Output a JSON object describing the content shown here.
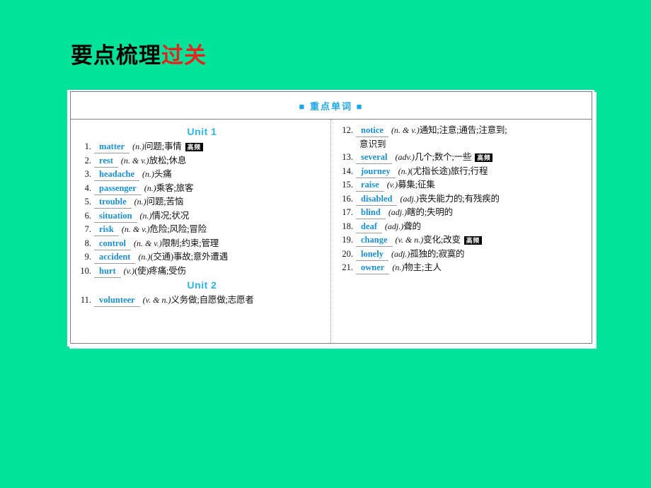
{
  "page": {
    "title_black": "要点梳理",
    "title_red": "过关"
  },
  "card": {
    "header": "■ 重点单词 ■",
    "left_column": {
      "unit_heading": "Unit 1",
      "unit_heading_2": "Unit 2",
      "entries": [
        {
          "num": "1",
          "word": "matter",
          "pos": "(n.)",
          "def": "问题;事情",
          "badge": "高频"
        },
        {
          "num": "2",
          "word": "rest",
          "pos": "(n. & v.)",
          "def": "放松;休息",
          "badge": ""
        },
        {
          "num": "3",
          "word": "headache",
          "pos": "(n.)",
          "def": "头痛",
          "badge": ""
        },
        {
          "num": "4",
          "word": "passenger",
          "pos": "(n.)",
          "def": "乘客;旅客",
          "badge": ""
        },
        {
          "num": "5",
          "word": "trouble",
          "pos": "(n.)",
          "def": "问题;苦恼",
          "badge": ""
        },
        {
          "num": "6",
          "word": "situation",
          "pos": "(n.)",
          "def": "情况;状况",
          "badge": ""
        },
        {
          "num": "7",
          "word": "risk",
          "pos": "(n. & v.)",
          "def": "危险;风险;冒险",
          "badge": ""
        },
        {
          "num": "8",
          "word": "control",
          "pos": "(n. & v.)",
          "def": "限制;约束;管理",
          "badge": ""
        },
        {
          "num": "9",
          "word": "accident",
          "pos": "(n.)",
          "def": "(交通)事故;意外遭遇",
          "badge": ""
        },
        {
          "num": "10",
          "word": "hurt",
          "pos": "(v.)",
          "def": "(使)疼痛;受伤",
          "badge": ""
        }
      ],
      "entries_unit2": [
        {
          "num": "11",
          "word": "volunteer",
          "pos": "(v. & n.)",
          "def": "义务做;自愿做;志愿者",
          "badge": ""
        }
      ]
    },
    "right_column": {
      "entries": [
        {
          "num": "12",
          "word": "notice",
          "pos": "(n. & v.)",
          "def": "通知;注意;通告;注意到;",
          "badge": "",
          "continuation": "意识到"
        },
        {
          "num": "13",
          "word": "several",
          "pos": "(adv.)",
          "def": "几个;数个;一些",
          "badge": "高频"
        },
        {
          "num": "14",
          "word": "journey",
          "pos": "(n.)",
          "def": "(尤指长途)旅行;行程",
          "badge": ""
        },
        {
          "num": "15",
          "word": "raise",
          "pos": "(v.)",
          "def": "募集;征集",
          "badge": ""
        },
        {
          "num": "16",
          "word": "disabled",
          "pos": "(adj.)",
          "def": "丧失能力的;有残疾的",
          "badge": ""
        },
        {
          "num": "17",
          "word": "blind",
          "pos": "(adj.)",
          "def": "瞎的;失明的",
          "badge": ""
        },
        {
          "num": "18",
          "word": "deaf",
          "pos": "(adj.)",
          "def": "聋的",
          "badge": ""
        },
        {
          "num": "19",
          "word": "change",
          "pos": "(v. & n.)",
          "def": "变化;改变",
          "badge": "高频"
        },
        {
          "num": "20",
          "word": "lonely",
          "pos": "(adj.)",
          "def": "孤独的;寂寞的",
          "badge": ""
        },
        {
          "num": "21",
          "word": "owner",
          "pos": "(n.)",
          "def": "物主;主人",
          "badge": ""
        }
      ]
    }
  },
  "colors": {
    "background_green": "#01E29B",
    "title_red": "#E8231B",
    "header_blue": "#1FA5E8",
    "unit_blue": "#2CB3E8",
    "word_blue": "#1B8FD6",
    "badge_bg": "#000000"
  }
}
